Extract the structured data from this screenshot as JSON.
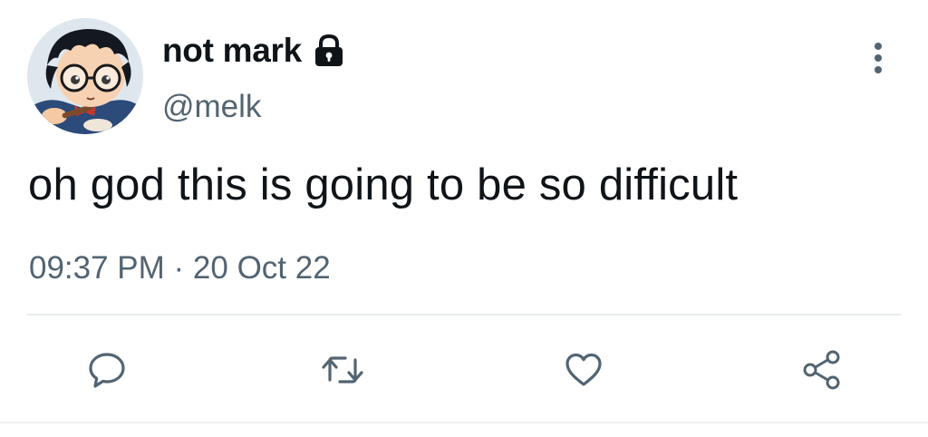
{
  "author": {
    "display_name": "not mark",
    "handle": "@melk",
    "protected": true,
    "avatar_icon": "anime-boy-glasses-avatar"
  },
  "tweet": {
    "text": "oh god this is going to be so difficult",
    "timestamp": "09:37 PM · 20 Oct 22"
  },
  "actions": [
    {
      "name": "reply",
      "icon": "speech-bubble-icon"
    },
    {
      "name": "retweet",
      "icon": "retweet-icon"
    },
    {
      "name": "like",
      "icon": "heart-icon"
    },
    {
      "name": "share",
      "icon": "share-icon"
    }
  ],
  "more_menu": {
    "icon": "vertical-ellipsis-icon"
  },
  "colors": {
    "text": "#0f1419",
    "secondary": "#536471",
    "icon": "#536471",
    "divider": "#e8ecef"
  }
}
